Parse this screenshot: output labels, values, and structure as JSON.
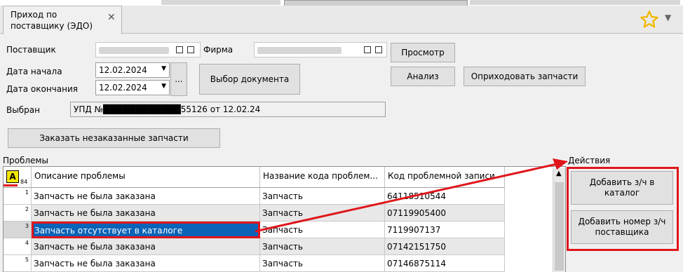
{
  "tab": {
    "title": "Приход по\nпоставщику (ЭДО)",
    "close": "✕"
  },
  "form": {
    "supplier_label": "Поставщик",
    "firm_label": "Фирма",
    "start_label": "Дата начала",
    "start_value": "12.02.2024",
    "end_label": "Дата окончания",
    "end_value": "12.02.2024",
    "ellipsis": "...",
    "selected_label": "Выбран",
    "selected_value": "УПД №████████████55126 от 12.02.24"
  },
  "buttons": {
    "view": "Просмотр",
    "choose_doc": "Выбор документа",
    "analysis": "Анализ",
    "receive_parts": "Оприходовать запчасти",
    "order_unordered": "Заказать незаказанные запчасти",
    "add_part_catalog": "Добавить з/ч в каталог",
    "add_supplier_number": "Добавить номер з/ч поставщика"
  },
  "sections": {
    "problems": "Проблемы",
    "actions": "Действия"
  },
  "grid": {
    "corner_label": "A",
    "corner_sub": "84",
    "columns": [
      "Описание проблемы",
      "Название кода проблем...",
      "Код проблемной записи"
    ],
    "rows": [
      {
        "n": "1",
        "desc": "Запчасть не была заказана",
        "name": "Запчасть",
        "code": "64118510544"
      },
      {
        "n": "2",
        "desc": "Запчасть не была заказана",
        "name": "Запчасть",
        "code": "07119905400"
      },
      {
        "n": "3",
        "desc": "Запчасть отсутствует в каталоге",
        "name": "Запчасть",
        "code": "7119907137"
      },
      {
        "n": "4",
        "desc": "Запчасть не была заказана",
        "name": "Запчасть",
        "code": "07142151750"
      },
      {
        "n": "5",
        "desc": "Запчасть не была заказана",
        "name": "Запчасть",
        "code": "07146875114"
      }
    ]
  },
  "colors": {
    "highlight": "#0b63b8",
    "annotation": "#e0151b",
    "star": "#f2b800"
  }
}
